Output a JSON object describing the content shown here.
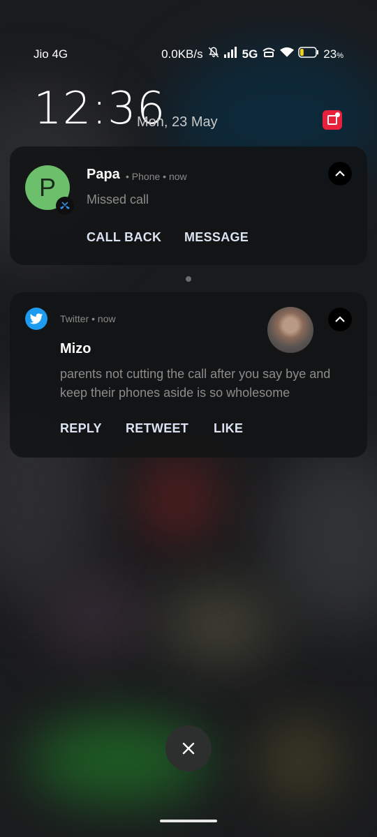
{
  "status_bar": {
    "carrier": "Jio 4G",
    "speed": "0.0KB/s",
    "network_type": "5G",
    "battery_value": "23",
    "battery_unit": "%",
    "battery_level": 0.23,
    "icons": [
      "mute-icon",
      "signal-icon",
      "volte-icon",
      "wifi-icon",
      "battery-icon"
    ]
  },
  "lock": {
    "time": "12:36",
    "date": "Mon, 23 May"
  },
  "notifications": [
    {
      "app": "Phone",
      "sender": "Papa",
      "separator": "•",
      "time": "now",
      "body": "Missed call",
      "avatar_letter": "P",
      "avatar_color": "#6cc06c",
      "actions": [
        "CALL BACK",
        "MESSAGE"
      ]
    },
    {
      "app": "Twitter",
      "separator": "•",
      "time": "now",
      "title": "Mizo",
      "body": "parents not cutting the call after you say bye and keep their phones aside is so wholesome",
      "actions": [
        "REPLY",
        "RETWEET",
        "LIKE"
      ],
      "accent": "#1d9bf0"
    }
  ],
  "colors": {
    "action_text": "#dbe2f1",
    "red_badge": "#e8203c"
  }
}
